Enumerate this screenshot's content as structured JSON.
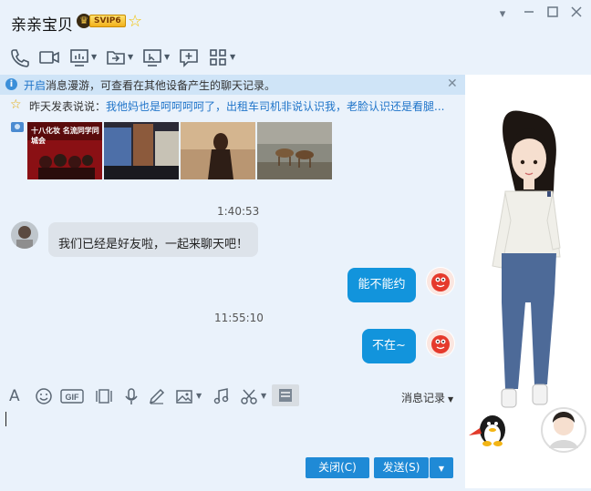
{
  "window": {
    "title": "亲亲宝贝",
    "vip_badge": "SVIP6"
  },
  "toolbar": {
    "icons": [
      "phone-icon",
      "video-call-icon",
      "screen-share-icon",
      "send-file-icon",
      "remote-assist-icon",
      "new-message-icon",
      "apps-grid-icon"
    ]
  },
  "notice": {
    "link_text": "开启",
    "text": "消息漫游，可查看在其他设备产生的聊天记录。"
  },
  "mood": {
    "label": "昨天发表说说：",
    "text": "我他妈也是呵呵呵呵了，出租车司机非说认识我，老脸认识还是看腿..."
  },
  "photos": [
    {
      "caption": "十八化妆 名流同学同城会"
    },
    {
      "caption": ""
    },
    {
      "caption": ""
    },
    {
      "caption": ""
    }
  ],
  "chat": {
    "messages": [
      {
        "time": "1:40:53",
        "side": "left",
        "text": "我们已经是好友啦，一起来聊天吧！"
      },
      {
        "time": "",
        "side": "right",
        "text": "能不能约"
      },
      {
        "time": "11:55:10",
        "side": "right",
        "text": "不在~"
      }
    ]
  },
  "input": {
    "history_label": "消息记录",
    "close_label": "关闭(C)",
    "send_label": "发送(S)"
  },
  "colors": {
    "accent": "#1294dc",
    "background": "#eaf2fb",
    "notice_bg": "#cfe4f7"
  }
}
